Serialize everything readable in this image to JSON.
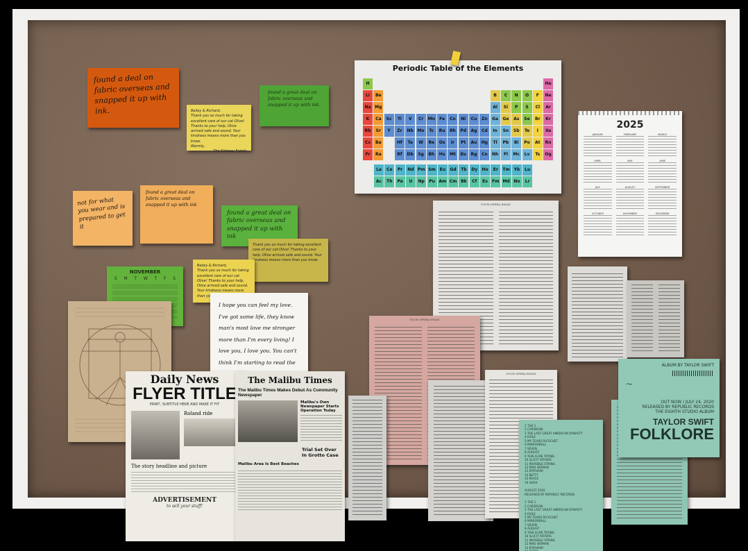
{
  "notes": {
    "orange_main": "found a deal on fabric overseas and snapped it up with ink.",
    "green_top": "found a great deal on fabric overseas and snapped it up with ink.",
    "yellow_letter_1": {
      "salutation": "Bailey & Richard,",
      "body": "Thank you so much for taking excellent care of our cat Olive! Thanks to your help, Olive arrived safe and sound. Your kindness means more than you know.",
      "closing": "Warmly,",
      "signature": "The Kirkway Family"
    },
    "orange_small": "not for what you wear and is prepared to get it",
    "orange_mid": "found a great deal on fabric overseas and snapped it up with ink",
    "green_mid": "found a great deal on fabric overseas and snapped it up with ink",
    "olive_letter": "Thank you so much for taking excellent care of our cat Olive! Thanks to your help, Olive arrived safe and sound. Your kindness means more than you know.",
    "yellow_letter_2": {
      "salutation": "Bailey & Richard,",
      "body": "Thank you so much for taking excellent care of our cat Olive! Thanks to your help, Olive arrived safe and sound. Your kindness means more than you know."
    },
    "white_note": "I hope you can feel my love. I've got some life, they know man's most love me stronger more than I'm every living! I love you, I love you. You can't think I'm starting to read the words message!"
  },
  "november_calendar": {
    "month": "NOVEMBER",
    "days": [
      "S",
      "M",
      "T",
      "W",
      "T",
      "F",
      "S"
    ]
  },
  "periodic_table": {
    "title": "Periodic Table of the Elements",
    "rows": [
      [
        "H",
        "",
        "",
        "",
        "",
        "",
        "",
        "",
        "",
        "",
        "",
        "",
        "",
        "",
        "",
        "",
        "",
        "He"
      ],
      [
        "Li",
        "Be",
        "",
        "",
        "",
        "",
        "",
        "",
        "",
        "",
        "",
        "",
        "B",
        "C",
        "N",
        "O",
        "F",
        "Ne"
      ],
      [
        "Na",
        "Mg",
        "",
        "",
        "",
        "",
        "",
        "",
        "",
        "",
        "",
        "",
        "Al",
        "Si",
        "P",
        "S",
        "Cl",
        "Ar"
      ],
      [
        "K",
        "Ca",
        "Sc",
        "Ti",
        "V",
        "Cr",
        "Mn",
        "Fe",
        "Co",
        "Ni",
        "Cu",
        "Zn",
        "Ga",
        "Ge",
        "As",
        "Se",
        "Br",
        "Kr"
      ],
      [
        "Rb",
        "Sr",
        "Y",
        "Zr",
        "Nb",
        "Mo",
        "Tc",
        "Ru",
        "Rh",
        "Pd",
        "Ag",
        "Cd",
        "In",
        "Sn",
        "Sb",
        "Te",
        "I",
        "Xe"
      ],
      [
        "Cs",
        "Ba",
        "",
        "Hf",
        "Ta",
        "W",
        "Re",
        "Os",
        "Ir",
        "Pt",
        "Au",
        "Hg",
        "Tl",
        "Pb",
        "Bi",
        "Po",
        "At",
        "Rn"
      ],
      [
        "Fr",
        "Ra",
        "",
        "Rf",
        "Db",
        "Sg",
        "Bh",
        "Hs",
        "Mt",
        "Ds",
        "Rg",
        "Cn",
        "Nh",
        "Fl",
        "Mc",
        "Lv",
        "Ts",
        "Og"
      ]
    ],
    "lanthanides": [
      "La",
      "Ce",
      "Pr",
      "Nd",
      "Pm",
      "Sm",
      "Eu",
      "Gd",
      "Tb",
      "Dy",
      "Ho",
      "Er",
      "Tm",
      "Yb",
      "Lu"
    ],
    "actinides": [
      "Ac",
      "Th",
      "Pa",
      "U",
      "Np",
      "Pu",
      "Am",
      "Cm",
      "Bk",
      "Cf",
      "Es",
      "Fm",
      "Md",
      "No",
      "Lr"
    ]
  },
  "calendar_2025": {
    "year": "2025",
    "months": [
      "JANUARY",
      "FEBRUARY",
      "MARCH",
      "APRIL",
      "MAY",
      "JUNE",
      "JULY",
      "AUGUST",
      "SEPTEMBER",
      "OCTOBER",
      "NOVEMBER",
      "DECEMBER"
    ]
  },
  "newspapers": {
    "daily_news": {
      "masthead": "Daily News",
      "title": "FLYER TITLE",
      "subtitle": "PRINT, SUBTITLE HERE AND MAKE IT FIT",
      "headline": "The story headline and picture",
      "sub_headline": "Roland ride",
      "ad": "ADVERTISEMENT",
      "ad_sub": "to sell your stuff!"
    },
    "malibu": {
      "masthead": "The Malibu Times",
      "headline": "The Malibu Times Makes Debut As Community Newspaper",
      "side_headline": "Malibu's Own Newspaper Starts Operation Today",
      "story_2": "Trial Set Over In Grotto Case",
      "story_3": "Malibu Area Is Best Beaches"
    }
  },
  "article_header": "YOUR OPERA ESSAY",
  "folklore": {
    "top_line": "ALBUM BY TAYLOR SWIFT",
    "release_line": "OUT NOW / JULY 24, 2020",
    "label_line": "RELEASED BY REPUBLIC RECORDS",
    "album_note": "THE EIGHTH STUDIO ALBUM",
    "artist": "TAYLOR SWIFT",
    "title": "FOLKLORE"
  },
  "tracklist": {
    "tracks": [
      "1 THE 1",
      "2 CARDIGAN",
      "3 THE LAST GREAT AMERICAN DYNASTY",
      "4 EXILE",
      "5 MY TEARS RICOCHET",
      "6 MIRRORBALL",
      "7 SEVEN",
      "8 AUGUST",
      "9 THIS IS ME TRYING",
      "10 ILLICIT AFFAIRS",
      "11 INVISIBLE STRING",
      "12 MAD WOMAN",
      "13 EPIPHANY",
      "14 BETTY",
      "15 PEACE",
      "16 HOAX"
    ],
    "mid": [
      "AUGUST 2020",
      "RELEASED BY REPUBLIC RECORDS"
    ],
    "tracks_2": [
      "1 THE 1",
      "2 CARDIGAN",
      "3 THE LAST GREAT AMERICAN DYNASTY",
      "4 EXILE",
      "5 MY TEARS RICOCHET",
      "6 MIRRORBALL",
      "7 SEVEN",
      "8 AUGUST",
      "9 THIS IS ME TRYING",
      "10 ILLICIT AFFAIRS",
      "11 INVISIBLE STRING",
      "12 MAD WOMAN",
      "13 EPIPHANY",
      "14 BETTY",
      "15 PEACE",
      "16 HOAX"
    ]
  },
  "colors": {
    "board": "#735d4d",
    "frame": "#f1f0ee",
    "note_orange": "#d4590f",
    "note_green": "#4ea535",
    "note_yellow": "#e9d65a",
    "note_light_orange": "#f3b466",
    "folklore_teal": "#8fc5b3"
  }
}
